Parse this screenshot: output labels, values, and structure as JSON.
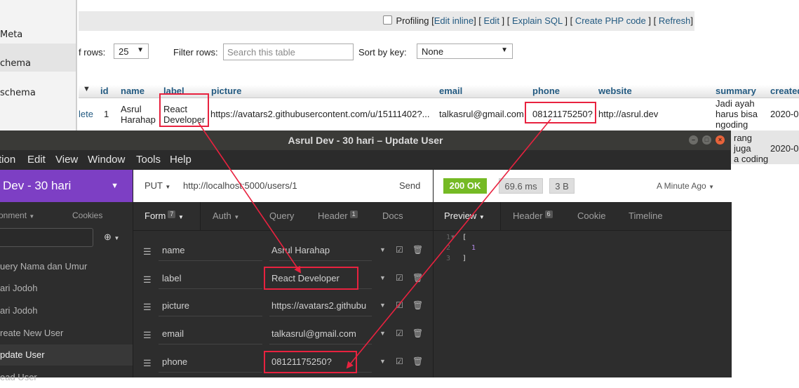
{
  "pma": {
    "sidebar_items": [
      "Meta",
      "chema",
      "schema"
    ],
    "toolbar": {
      "profiling_label": "Profiling",
      "links": [
        "Edit inline",
        "Edit",
        "Explain SQL",
        "Create PHP code",
        "Refresh"
      ]
    },
    "controls": {
      "rows_label": "f rows:",
      "rows_value": "25",
      "filter_label": "Filter rows:",
      "filter_placeholder": "Search this table",
      "sort_label": "Sort by key:",
      "sort_value": "None"
    },
    "table": {
      "columns": [
        "id",
        "name",
        "label",
        "picture",
        "email",
        "phone",
        "website",
        "summary",
        "created"
      ],
      "row": {
        "action": "lete",
        "id": "1",
        "name_line1": "Asrul",
        "name_line2": "Harahap",
        "label_line1": "React",
        "label_line2": "Developer",
        "picture": "https://avatars2.githubusercontent.com/u/15111402?...",
        "email": "talkasrul@gmail.com",
        "phone": "08121175250?",
        "website": "http://asrul.dev",
        "summary_line1": "Jadi ayah",
        "summary_line2": "harus bisa",
        "summary_line3": "ngoding",
        "created": "2020-0"
      },
      "row2": {
        "summary_line1": "rang",
        "summary_line2": "juga",
        "summary_line3": "a coding",
        "created": "2020-0"
      }
    }
  },
  "insomnia": {
    "title": "Asrul Dev - 30 hari – Update User",
    "menu": [
      "tion",
      "Edit",
      "View",
      "Window",
      "Tools",
      "Help"
    ],
    "workspace": "Dev - 30 hari",
    "environment": "onment",
    "cookies": "Cookies",
    "requests": [
      {
        "label": "uery Nama dan Umur",
        "active": false
      },
      {
        "label": "ari Jodoh",
        "active": false
      },
      {
        "label": "ari Jodoh",
        "active": false
      },
      {
        "label": "reate New User",
        "active": false
      },
      {
        "label": "pdate User",
        "active": true
      },
      {
        "label": "ead User",
        "active": false
      }
    ],
    "request": {
      "method": "PUT",
      "url": "http://localhost:5000/users/1",
      "send": "Send",
      "tabs": {
        "form": "Form",
        "form_count": "7",
        "auth": "Auth",
        "query": "Query",
        "header": "Header",
        "header_count": "1",
        "docs": "Docs"
      },
      "fields": [
        {
          "key": "name",
          "value": "Asrul Harahap"
        },
        {
          "key": "label",
          "value": "React Developer"
        },
        {
          "key": "picture",
          "value": "https://avatars2.githubu"
        },
        {
          "key": "email",
          "value": "talkasrul@gmail.com"
        },
        {
          "key": "phone",
          "value": "08121175250?"
        }
      ]
    },
    "response": {
      "status": "200 OK",
      "time": "69.6 ms",
      "size": "3 B",
      "ago": "A Minute Ago",
      "tabs": {
        "preview": "Preview",
        "header": "Header",
        "header_count": "6",
        "cookie": "Cookie",
        "timeline": "Timeline"
      },
      "lines": [
        {
          "n": "1",
          "text": "["
        },
        {
          "n": "2",
          "text": "1"
        },
        {
          "n": "3",
          "text": "]"
        }
      ]
    }
  },
  "colors": {
    "workspace": "#7d3fc4",
    "status_ok": "#75ba24",
    "annotation": "#e8223f",
    "pma_link": "#235a81"
  }
}
